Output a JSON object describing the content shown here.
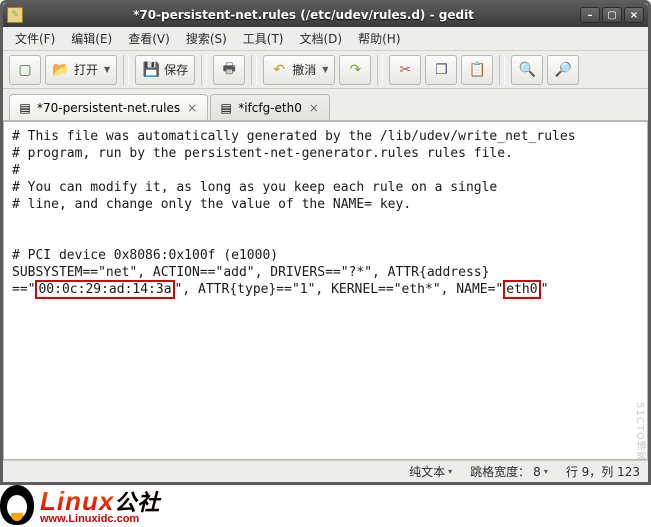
{
  "window": {
    "title": "*70-persistent-net.rules (/etc/udev/rules.d) - gedit"
  },
  "menu": {
    "file": "文件(F)",
    "edit": "编辑(E)",
    "view": "查看(V)",
    "search": "搜索(S)",
    "tools": "工具(T)",
    "documents": "文档(D)",
    "help": "帮助(H)"
  },
  "toolbar": {
    "new_tip": "新建",
    "open_label": "打开",
    "save_label": "保存",
    "print_tip": "打印",
    "undo_label": "撤消",
    "redo_tip": "重做",
    "cut_tip": "剪切",
    "copy_tip": "复制",
    "paste_tip": "粘贴",
    "find_tip": "查找",
    "replace_tip": "替换"
  },
  "tabs": [
    {
      "label": "*70-persistent-net.rules",
      "active": true
    },
    {
      "label": "*ifcfg-eth0",
      "active": false
    }
  ],
  "doc_lines": {
    "l1": "# This file was automatically generated by the /lib/udev/write_net_rules",
    "l2": "# program, run by the persistent-net-generator.rules rules file.",
    "l3": "#",
    "l4": "# You can modify it, as long as you keep each rule on a single",
    "l5": "# line, and change only the value of the NAME= key.",
    "l6": "",
    "l7": "",
    "l8": "# PCI device 0x8086:0x100f (e1000)",
    "l9a": "SUBSYSTEM==\"net\", ACTION==\"add\", DRIVERS==\"?*\", ATTR{address}",
    "l9b_pre": "==\"",
    "l9b_mac": "00:0c:29:ad:14:3a",
    "l9b_mid": "\", ATTR{type}==\"1\", KERNEL==\"eth*\", NAME=\"",
    "l9b_name": "eth0",
    "l9b_post": "\""
  },
  "status": {
    "mode": "纯文本",
    "tabwidth_label": "跳格宽度：",
    "tabwidth_value": "8",
    "position": "行 9，列 123"
  },
  "branding": {
    "site_name_en": "Linux",
    "site_name_zh": "公社",
    "url": "www.Linuxidc.com"
  },
  "watermark": "51CTO博客"
}
